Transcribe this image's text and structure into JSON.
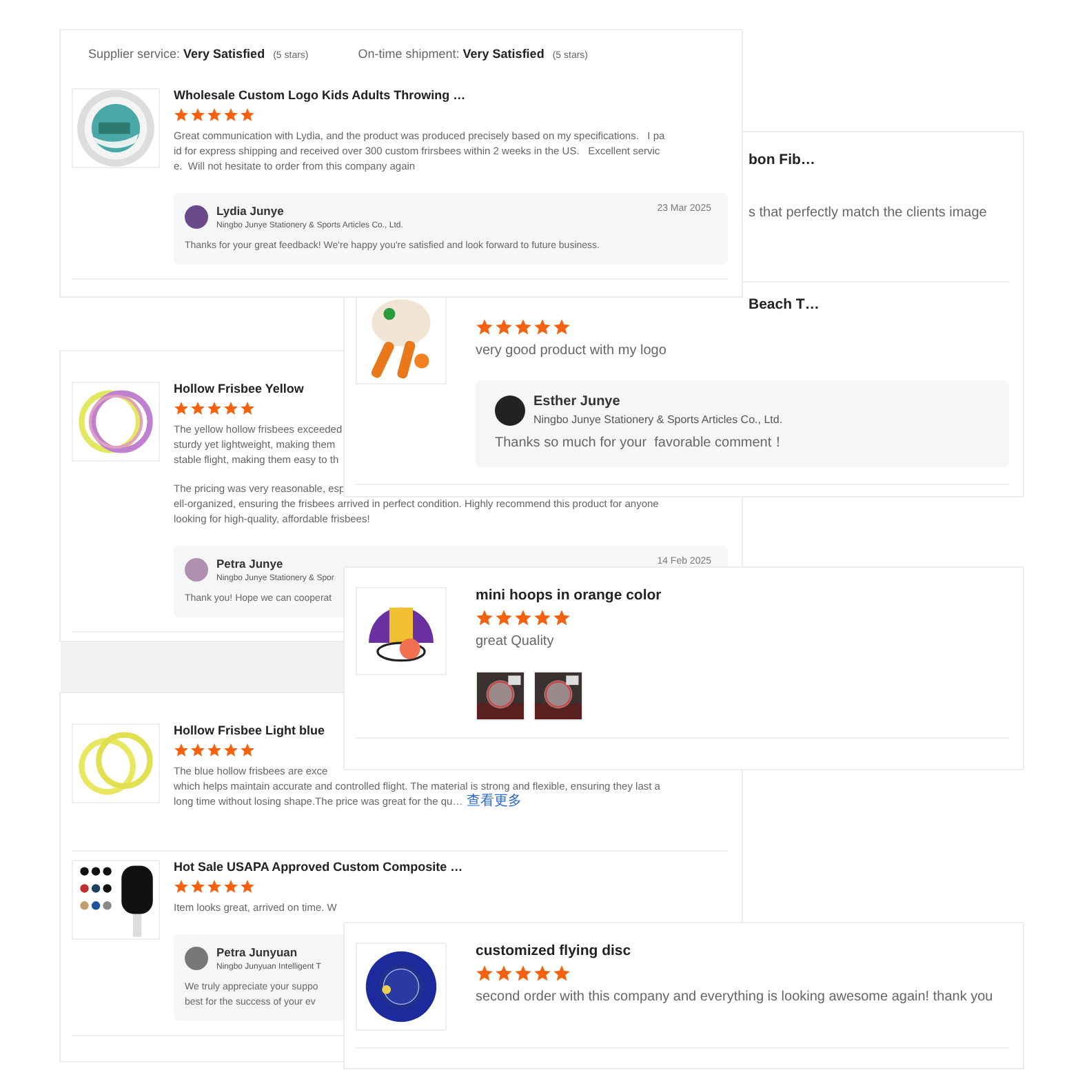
{
  "cards": [
    {
      "ratings": [
        {
          "label": "Supplier service: **Very Satisfied**",
          "note": "(5 stars)"
        },
        {
          "label": "On-time shipment: **Very Satisfied**",
          "note": "(5 stars)"
        }
      ],
      "reviews": [
        {
          "thumb": {
            "kind": "picture"
          },
          "title": "Wholesale Custom Logo Kids Adults Throwing …",
          "stars": 5,
          "paragraphs": [
            [
              "Great communication with Lydia, and the product was produced precisely based on my specifications.   I pa",
              "id for express shipping and received over 300 custom frirsbees within 2 weeks in the US.   Excellent servic",
              "e.  Will not hesitate to order from this company again"
            ]
          ],
          "reply": {
            "name": "Lydia Junye",
            "company": "Ningbo Junye Stationery & Sports Articles Co., Ltd.",
            "date": "23 Mar 2025",
            "lines": [
              "Thanks for your great feedback! We're happy you're satisfied and look forward to future business."
            ]
          }
        }
      ]
    },
    {
      "reviews": [
        {
          "title": "bon Fib…",
          "paragraphs": [
            [
              "s that perfectly match the clients image"
            ]
          ]
        },
        {
          "thumb": {
            "kind": "picture"
          },
          "title": "Beach T…",
          "stars": 5,
          "paragraphs": [
            [
              "very good product with my logo"
            ]
          ],
          "reply": {
            "name": "Esther Junye",
            "company": "Ningbo Junye Stationery & Sports Articles Co., Ltd.",
            "lines": [
              "Thanks so much for your  favorable comment！"
            ]
          }
        }
      ]
    },
    {
      "reviews": [
        {
          "thumb": {
            "kind": "picture"
          },
          "title": "Hollow Frisbee Yellow",
          "stars": 5,
          "paragraphs": [
            [
              "The yellow hollow frisbees exceeded",
              "sturdy yet lightweight, making them",
              "stable flight, making them easy to th"
            ],
            [
              "The pricing was very reasonable, esp",
              "ell-organized, ensuring the frisbees arrived in perfect condition. Highly recommend this product for anyone",
              "looking for high-quality, affordable frisbees!"
            ]
          ],
          "reply": {
            "name": "Petra Junye",
            "company": "Ningbo Junye Stationery & Spor",
            "date": "14 Feb 2025",
            "lines": [
              "Thank you! Hope we can cooperat"
            ]
          }
        }
      ]
    },
    {
      "reviews": [
        {
          "thumb": {
            "kind": "picture"
          },
          "title": "mini hoops in orange color",
          "stars": 5,
          "paragraphs": [
            [
              "great Quality"
            ]
          ],
          "photos": [
            {
              "kind": "picture"
            },
            {
              "kind": "picture"
            }
          ]
        }
      ]
    },
    {
      "reviews": [
        {
          "thumb": {
            "kind": "picture"
          },
          "title": "Hollow Frisbee Light blue",
          "stars": 5,
          "paragraphs": [
            [
              "The blue hollow frisbees are exce",
              "which helps maintain accurate and controlled flight. The material is strong and flexible, ensuring they last a",
              "long time without losing shape.The price was great for the qu…"
            ]
          ],
          "more": "查看更多"
        },
        {
          "thumb": {
            "kind": "picture"
          },
          "title": "Hot Sale USAPA Approved Custom Composite …",
          "stars": 5,
          "paragraphs": [
            [
              "Item looks great, arrived on time. W"
            ]
          ],
          "reply": {
            "name": "Petra Junyuan",
            "company": "Ningbo Junyuan Intelligent T",
            "lines": [
              "We truly appreciate your suppo",
              "best for the success of your ev"
            ]
          }
        }
      ]
    },
    {
      "reviews": [
        {
          "thumb": {
            "kind": "picture"
          },
          "title": "customized flying disc",
          "stars": 5,
          "paragraphs": [
            [
              "second order with this company and everything is looking awesome again! thank you"
            ]
          ]
        }
      ]
    }
  ]
}
